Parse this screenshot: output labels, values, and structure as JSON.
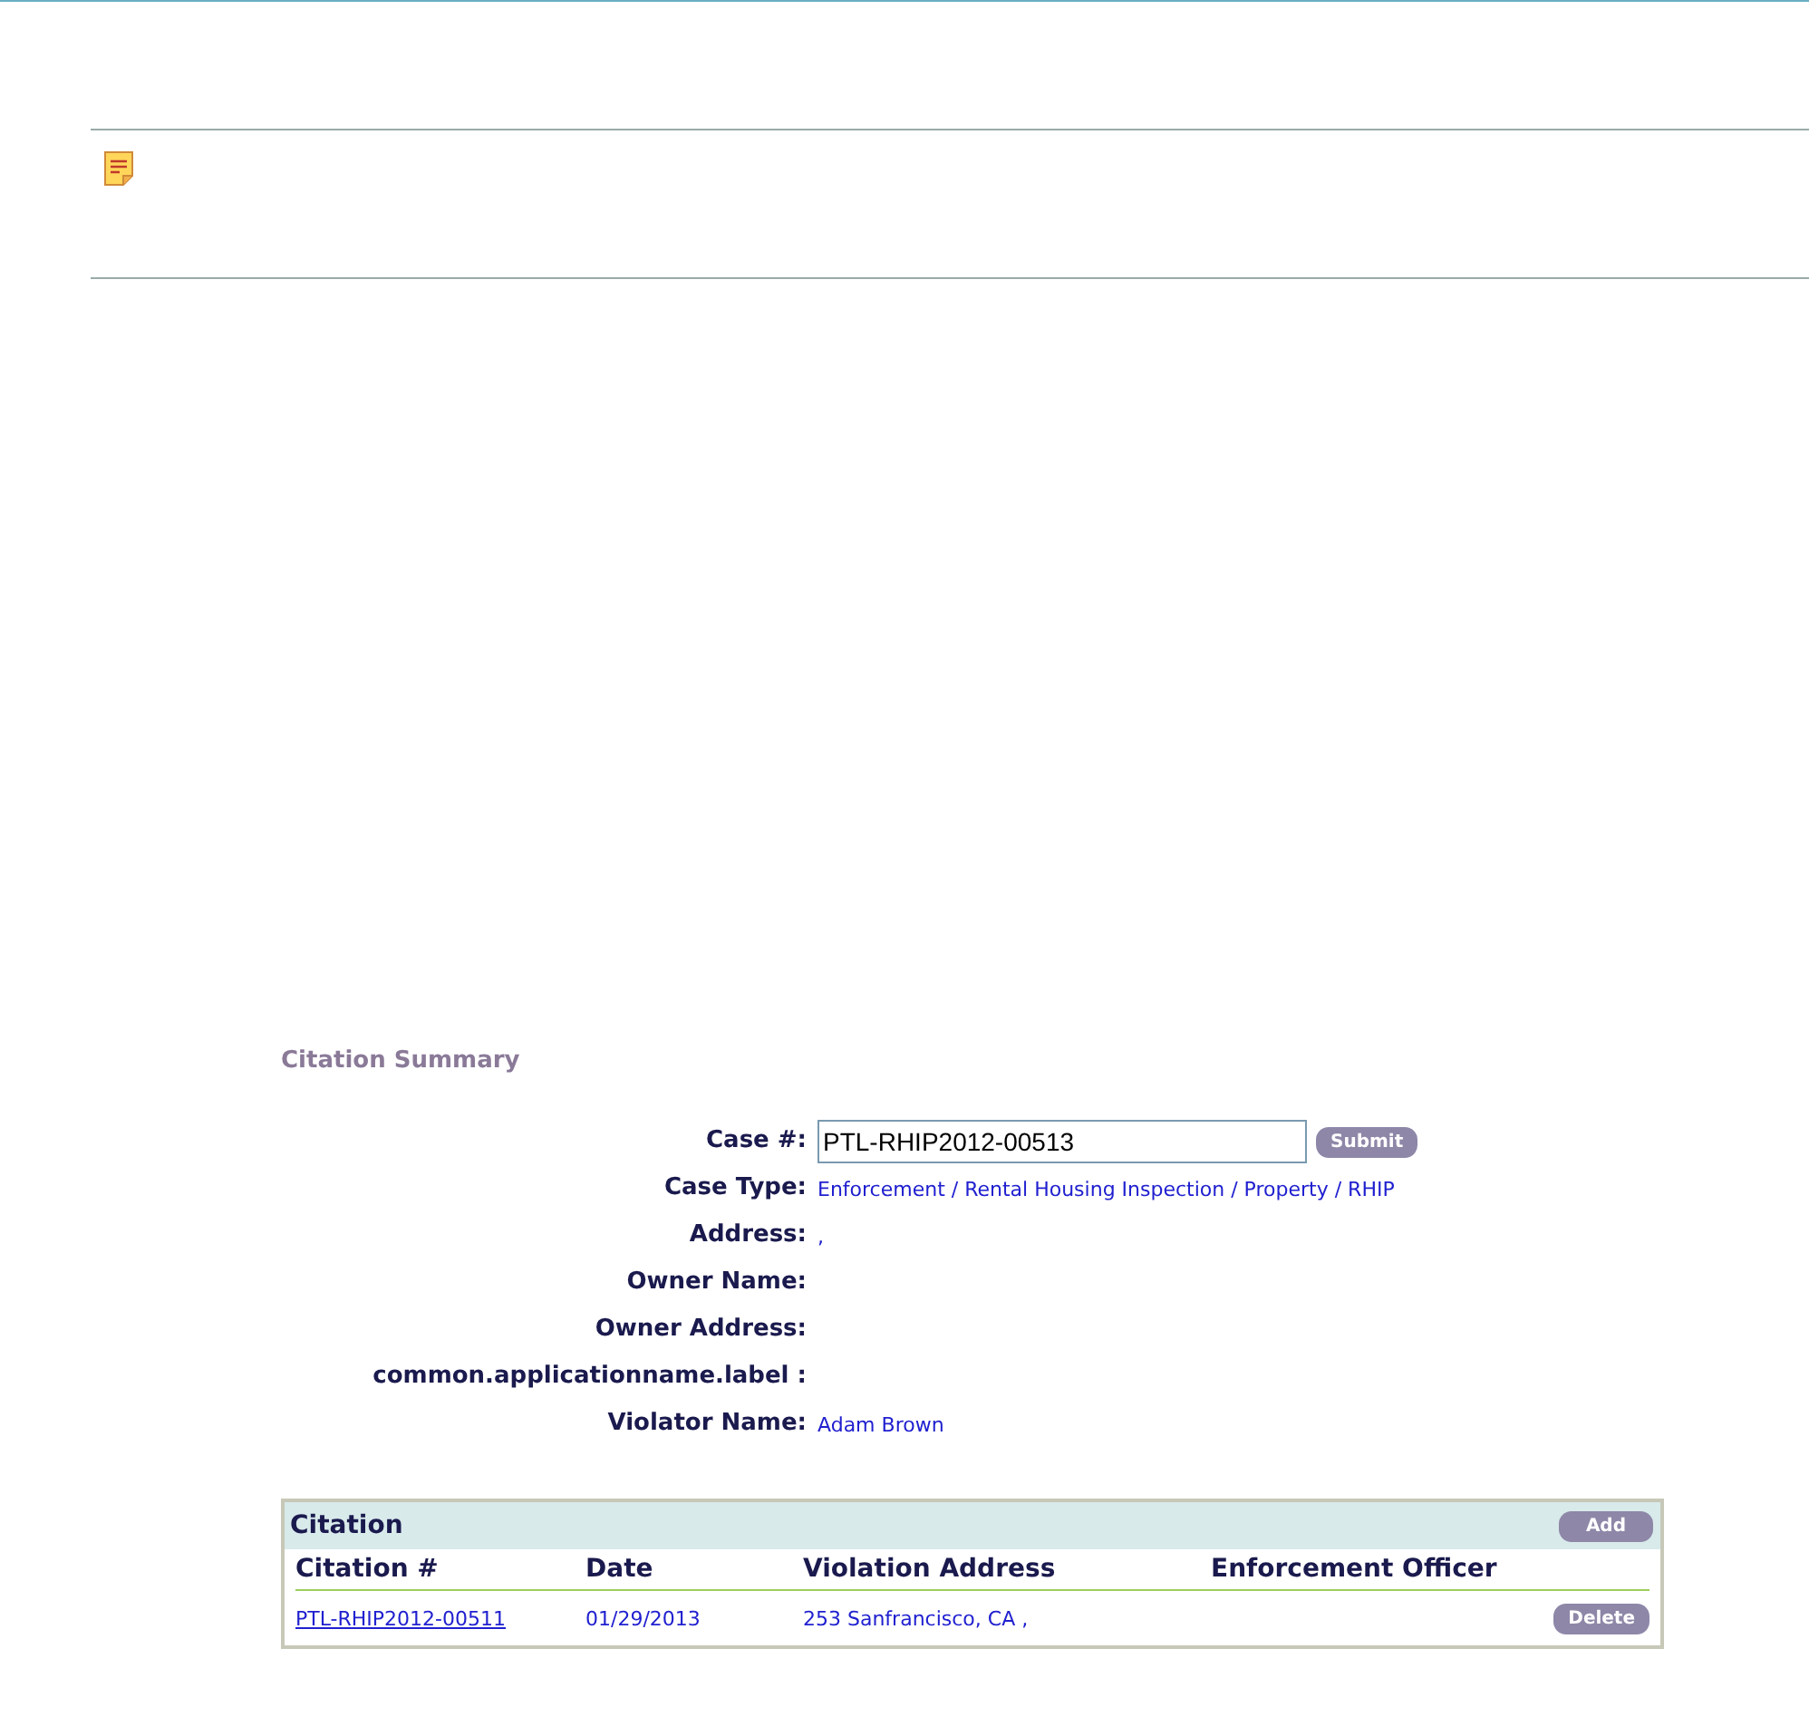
{
  "summary": {
    "title": "Citation Summary",
    "fields": [
      {
        "kind": "input",
        "label": "Case #:",
        "value": "PTL-RHIP2012-00513",
        "button": "Submit"
      },
      {
        "kind": "text",
        "label": "Case Type:",
        "value": "Enforcement / Rental Housing Inspection / Property / RHIP"
      },
      {
        "kind": "text",
        "label": "Address:",
        "value": ","
      },
      {
        "kind": "text",
        "label": "Owner Name:"
      },
      {
        "kind": "text",
        "label": "Owner Address:"
      },
      {
        "kind": "text",
        "label": "common.applicationname.label :"
      },
      {
        "kind": "text",
        "label": "Violator Name:",
        "value": "Adam Brown"
      }
    ]
  },
  "citation": {
    "title": "Citation",
    "add_button": "Add",
    "columns": [
      "Citation #",
      "Date",
      "Violation Address",
      "Enforcement Officer"
    ],
    "rows": [
      {
        "citation": "PTL-RHIP2012-00511",
        "date": "01/29/2013",
        "address": "253 Sanfrancisco, CA ,",
        "action": "Delete"
      }
    ]
  }
}
